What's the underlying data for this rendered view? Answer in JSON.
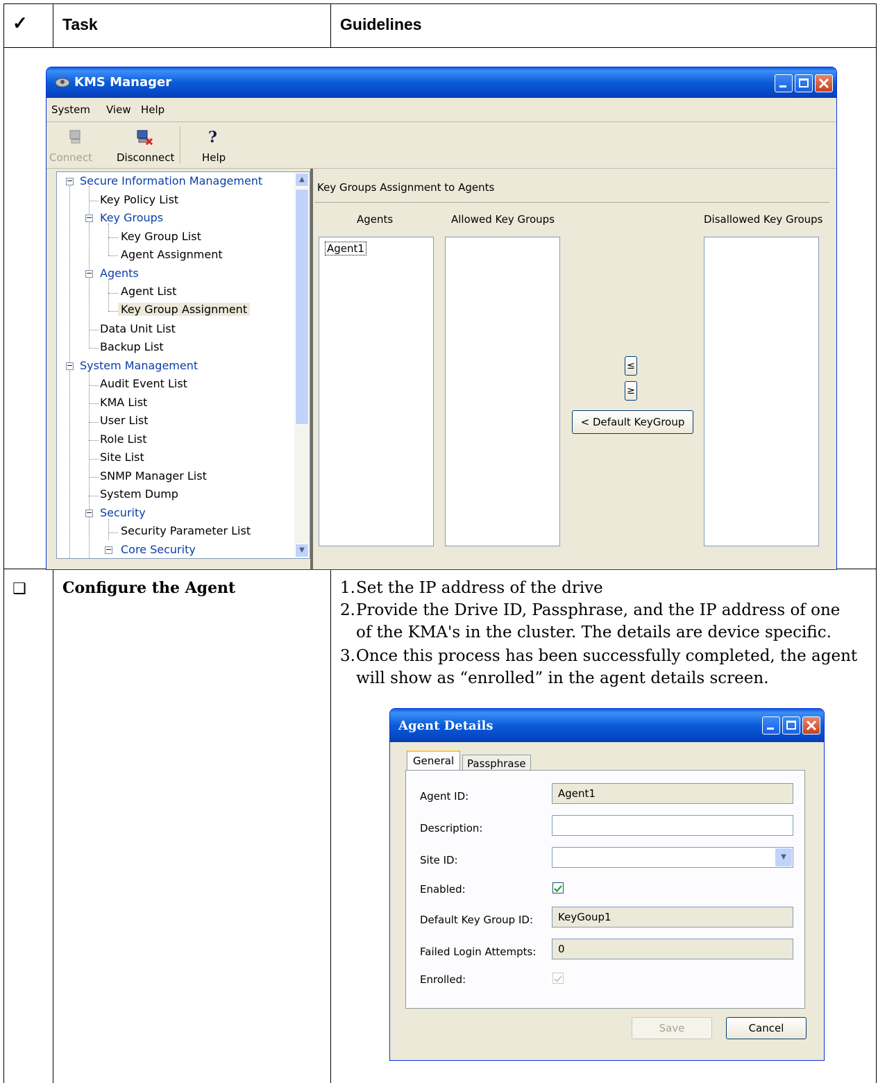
{
  "table": {
    "check_header": "✓",
    "task_header": "Task",
    "guidelines_header": "Guidelines",
    "row_checkbox": "❑",
    "task_text": "Configure the Agent",
    "steps": [
      {
        "num": "1.",
        "lines": [
          "Set the IP address of the drive"
        ]
      },
      {
        "num": "2.",
        "lines": [
          "Provide the Drive ID, Passphrase, and the IP address of one",
          "of the KMA's in the cluster.  The details are device specific."
        ]
      },
      {
        "num": "3.",
        "lines": [
          "Once this process has been successfully completed, the agent",
          "will show as “enrolled” in the agent details screen."
        ]
      }
    ]
  },
  "kms": {
    "title": "KMS Manager",
    "menu": [
      "System",
      "View",
      "Help"
    ],
    "toolbar": {
      "connect": "Connect",
      "disconnect": "Disconnect",
      "help": "Help"
    },
    "tree": [
      "Secure Information Management",
      "Key Policy List",
      "Key Groups",
      "Key Group List",
      "Agent Assignment",
      "Agents",
      "Agent List",
      "Key Group Assignment",
      "Data Unit List",
      "Backup List",
      "System Management",
      "Audit Event List",
      "KMA List",
      "User List",
      "Role List",
      "Site List",
      "SNMP Manager List",
      "System Dump",
      "Security",
      "Security Parameter List",
      "Core Security"
    ],
    "panel_title": "Key Groups Assignment to Agents",
    "col_agents": "Agents",
    "col_allowed": "Allowed Key Groups",
    "col_disallowed": "Disallowed Key Groups",
    "agents_list": [
      "Agent1"
    ],
    "btn_left": "≤",
    "btn_right": "≥",
    "btn_default": "< Default KeyGroup"
  },
  "agent_details": {
    "title": "Agent Details",
    "tabs": [
      "General",
      "Passphrase"
    ],
    "labels": {
      "agent_id": "Agent ID:",
      "description": "Description:",
      "site_id": "Site ID:",
      "enabled": "Enabled:",
      "default_key_group": "Default Key Group ID:",
      "failed_login": "Failed Login Attempts:",
      "enrolled": "Enrolled:"
    },
    "values": {
      "agent_id": "Agent1",
      "description": "",
      "site_id": "",
      "default_key_group": "KeyGoup1",
      "failed_login": "0"
    },
    "enabled": true,
    "enrolled": true,
    "save": "Save",
    "cancel": "Cancel"
  }
}
